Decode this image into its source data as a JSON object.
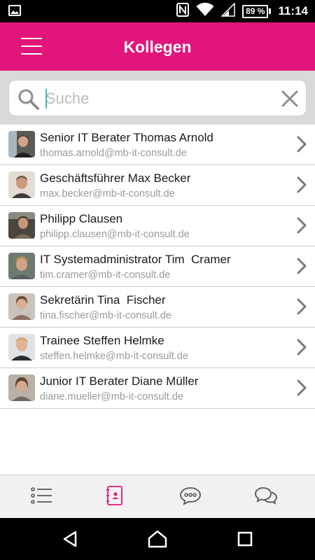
{
  "status_bar": {
    "time": "11:14",
    "battery": "89 %",
    "icons": [
      "image-icon",
      "nfc-icon",
      "wifi-icon",
      "signal-icon",
      "battery-icon"
    ]
  },
  "app_bar": {
    "title": "Kollegen",
    "menu_icon": "hamburger-menu-icon",
    "color": "#e2157c"
  },
  "search": {
    "placeholder": "Suche",
    "value": "",
    "search_icon": "search-icon",
    "clear_icon": "close-icon"
  },
  "contacts": [
    {
      "title": "Senior IT Berater Thomas Arnold",
      "email": "thomas.arnold@mb-it-consult.de"
    },
    {
      "title": "Geschäftsführer Max Becker",
      "email": "max.becker@mb-it-consult.de"
    },
    {
      "title": "Philipp Clausen",
      "email": "philipp.clausen@mb-it-consult.de"
    },
    {
      "title": "IT Systemadministrator Tim  Cramer",
      "email": "tim.cramer@mb-it-consult.de"
    },
    {
      "title": "Sekretärin Tina  Fischer",
      "email": "tina.fischer@mb-it-consult.de"
    },
    {
      "title": "Trainee Steffen Helmke",
      "email": "steffen.helmke@mb-it-consult.de"
    },
    {
      "title": "Junior IT Berater Diane Müller",
      "email": "diane.mueller@mb-it-consult.de"
    }
  ],
  "tab_bar": {
    "tabs": [
      {
        "icon": "list-icon",
        "active": false
      },
      {
        "icon": "address-book-icon",
        "active": true
      },
      {
        "icon": "chat-bubble-icon",
        "active": false
      },
      {
        "icon": "conversations-icon",
        "active": false
      }
    ],
    "active_color": "#e2157c",
    "inactive_color": "#555555"
  },
  "nav_bar": {
    "buttons": [
      "back-icon",
      "home-icon",
      "recents-icon"
    ]
  }
}
